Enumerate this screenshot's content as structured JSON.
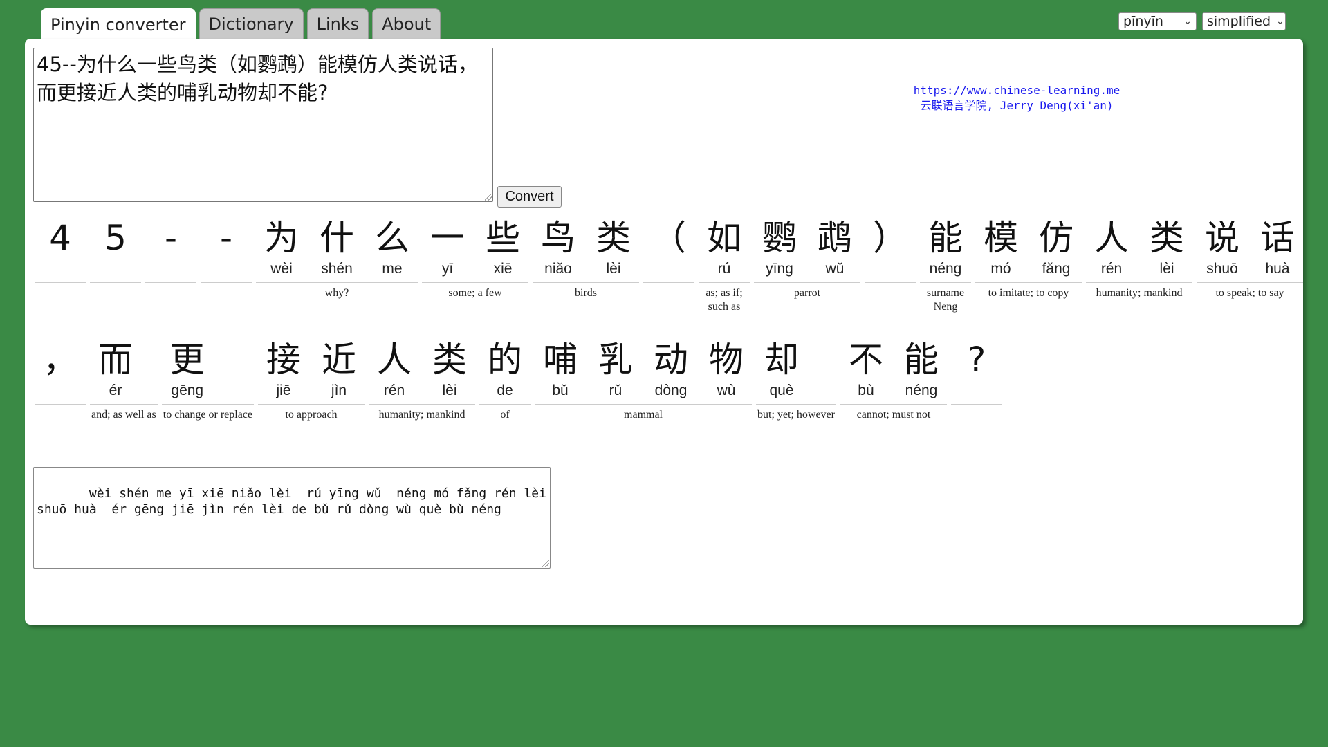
{
  "tabs": [
    {
      "label": "Pinyin converter",
      "active": true
    },
    {
      "label": "Dictionary"
    },
    {
      "label": "Links"
    },
    {
      "label": "About"
    }
  ],
  "selects": {
    "tone_mode": "pīnyīn",
    "script": "simplified"
  },
  "input_text": "45--为什么一些鸟类（如鹦鹉）能模仿人类说话，而更接近人类的哺乳动物却不能?",
  "convert_label": "Convert",
  "credits": {
    "url": "https://www.chinese-learning.me",
    "author": "云联语言学院, Jerry Deng(xi'an)"
  },
  "rows": [
    [
      {
        "chars": [
          {
            "h": "4",
            "p": ""
          }
        ],
        "gloss": ""
      },
      {
        "chars": [
          {
            "h": "5",
            "p": ""
          }
        ],
        "gloss": ""
      },
      {
        "chars": [
          {
            "h": "-",
            "p": ""
          }
        ],
        "gloss": ""
      },
      {
        "chars": [
          {
            "h": "-",
            "p": ""
          }
        ],
        "gloss": ""
      },
      {
        "chars": [
          {
            "h": "为",
            "p": "wèi"
          },
          {
            "h": "什",
            "p": "shén"
          },
          {
            "h": "么",
            "p": "me"
          }
        ],
        "gloss": "why?"
      },
      {
        "chars": [
          {
            "h": "一",
            "p": "yī"
          },
          {
            "h": "些",
            "p": "xiē"
          }
        ],
        "gloss": "some; a few"
      },
      {
        "chars": [
          {
            "h": "鸟",
            "p": "niǎo"
          },
          {
            "h": "类",
            "p": "lèi"
          }
        ],
        "gloss": "birds"
      },
      {
        "chars": [
          {
            "h": "（",
            "p": ""
          }
        ],
        "gloss": ""
      },
      {
        "chars": [
          {
            "h": "如",
            "p": "rú"
          }
        ],
        "gloss": "as; as if; such as"
      },
      {
        "chars": [
          {
            "h": "鹦",
            "p": "yīng"
          },
          {
            "h": "鹉",
            "p": "wǔ"
          }
        ],
        "gloss": "parrot"
      },
      {
        "chars": [
          {
            "h": "）",
            "p": ""
          }
        ],
        "gloss": ""
      },
      {
        "chars": [
          {
            "h": "能",
            "p": "néng"
          }
        ],
        "gloss": "surname Neng"
      },
      {
        "chars": [
          {
            "h": "模",
            "p": "mó"
          },
          {
            "h": "仿",
            "p": "fǎng"
          }
        ],
        "gloss": "to imitate; to copy"
      },
      {
        "chars": [
          {
            "h": "人",
            "p": "rén"
          },
          {
            "h": "类",
            "p": "lèi"
          }
        ],
        "gloss": "humanity; mankind"
      },
      {
        "chars": [
          {
            "h": "说",
            "p": "shuō"
          },
          {
            "h": "话",
            "p": "huà"
          }
        ],
        "gloss": "to speak; to say"
      }
    ],
    [
      {
        "chars": [
          {
            "h": "，",
            "p": ""
          }
        ],
        "gloss": ""
      },
      {
        "chars": [
          {
            "h": "而",
            "p": "ér"
          }
        ],
        "gloss": "and; as well as"
      },
      {
        "chars": [
          {
            "h": "更",
            "p": "gēng"
          }
        ],
        "gloss": "to change or replace"
      },
      {
        "chars": [
          {
            "h": "接",
            "p": "jiē"
          },
          {
            "h": "近",
            "p": "jìn"
          }
        ],
        "gloss": "to approach"
      },
      {
        "chars": [
          {
            "h": "人",
            "p": "rén"
          },
          {
            "h": "类",
            "p": "lèi"
          }
        ],
        "gloss": "humanity; mankind"
      },
      {
        "chars": [
          {
            "h": "的",
            "p": "de"
          }
        ],
        "gloss": "of"
      },
      {
        "chars": [
          {
            "h": "哺",
            "p": "bǔ"
          },
          {
            "h": "乳",
            "p": "rǔ"
          },
          {
            "h": "动",
            "p": "dòng"
          },
          {
            "h": "物",
            "p": "wù"
          }
        ],
        "gloss": "mammal"
      },
      {
        "chars": [
          {
            "h": "却",
            "p": "què"
          }
        ],
        "gloss": "but; yet; however"
      },
      {
        "chars": [
          {
            "h": "不",
            "p": "bù"
          },
          {
            "h": "能",
            "p": "néng"
          }
        ],
        "gloss": "cannot; must not"
      },
      {
        "chars": [
          {
            "h": "?",
            "p": ""
          }
        ],
        "gloss": ""
      }
    ]
  ],
  "output_text": "   wèi shén me yī xiē niǎo lèi  rú yīng wǔ  néng mó fǎng rén lèi shuō huà  ér gēng jiē jìn rén lèi de bǔ rǔ dòng wù què bù néng"
}
